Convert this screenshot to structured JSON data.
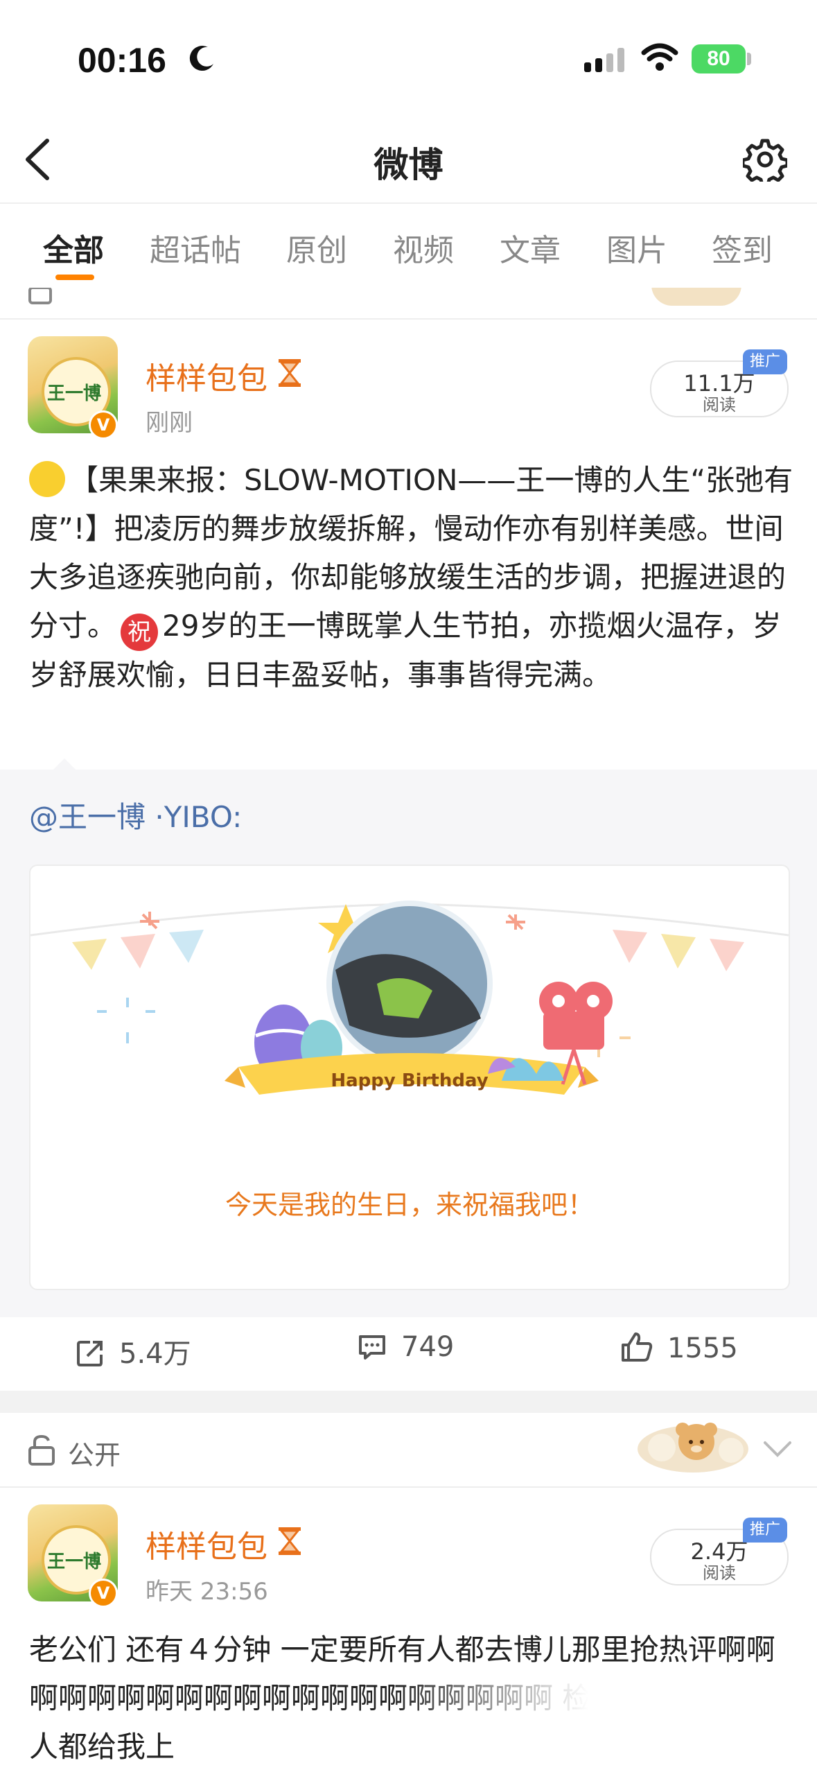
{
  "status_bar": {
    "time": "00:16",
    "battery": "80"
  },
  "nav": {
    "title": "微博"
  },
  "tabs": [
    {
      "label": "全部",
      "active": true
    },
    {
      "label": "超话帖"
    },
    {
      "label": "原创"
    },
    {
      "label": "视频"
    },
    {
      "label": "文章"
    },
    {
      "label": "图片"
    },
    {
      "label": "签到"
    }
  ],
  "post1": {
    "author": "样样包包",
    "time": "刚刚",
    "read_count": "11.1万",
    "read_label": "阅读",
    "promo_badge": "推广",
    "text_part1": "【果果来报：SLOW-MOTION——王一博的人生“张弛有度”!】把凌厉的舞步放缓拆解，慢动作亦有别样美感。世间大多追逐疾驰向前，你却能够放缓生活的步调，把握进退的分寸。",
    "zhu_badge": "祝",
    "text_part2": "29岁的王一博既掌人生节拍，亦揽烟火温存，岁岁舒展欢愉，日日丰盈妥帖，事事皆得完满。",
    "repost_author": "@王一博 ·YIBO:",
    "card": {
      "ribbon_text": "Happy Birthday",
      "caption": "今天是我的生日，来祝福我吧！"
    },
    "actions": {
      "reposts": "5.4万",
      "comments": "749",
      "likes": "1555"
    }
  },
  "post2": {
    "visibility": "公开",
    "author": "样样包包",
    "time": "昨天 23:56",
    "read_count": "2.4万",
    "read_label": "阅读",
    "promo_badge": "推广",
    "text": "老公们 还有４分钟 一定要所有人都去博儿那里抢热评啊啊啊啊啊啊啊啊啊啊啊啊啊啊啊啊啊啊啊啊 检查好文案，所有人都给我上"
  },
  "avatar_text": "王一博",
  "colors": {
    "accent": "#ff8200",
    "username": "#e8701a",
    "link": "#4a6ea8",
    "promo": "#5b8ee6"
  }
}
